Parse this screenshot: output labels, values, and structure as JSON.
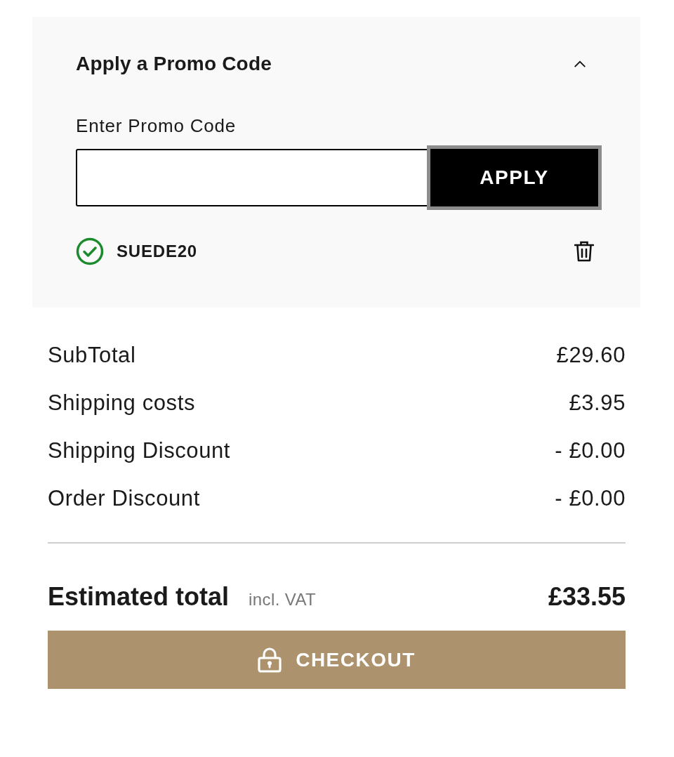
{
  "promo": {
    "title": "Apply a Promo Code",
    "expanded": true,
    "field_label": "Enter Promo Code",
    "apply_button": "APPLY",
    "applied_codes": [
      {
        "code": "SUEDE20"
      }
    ]
  },
  "summary": {
    "rows": [
      {
        "label": "SubTotal",
        "value": "£29.60"
      },
      {
        "label": "Shipping costs",
        "value": "£3.95"
      },
      {
        "label": "Shipping Discount",
        "value": "- £0.00"
      },
      {
        "label": "Order Discount",
        "value": "- £0.00"
      }
    ]
  },
  "total": {
    "label": "Estimated total",
    "note": "incl. VAT",
    "value": "£33.55"
  },
  "checkout_button": "CHECKOUT"
}
